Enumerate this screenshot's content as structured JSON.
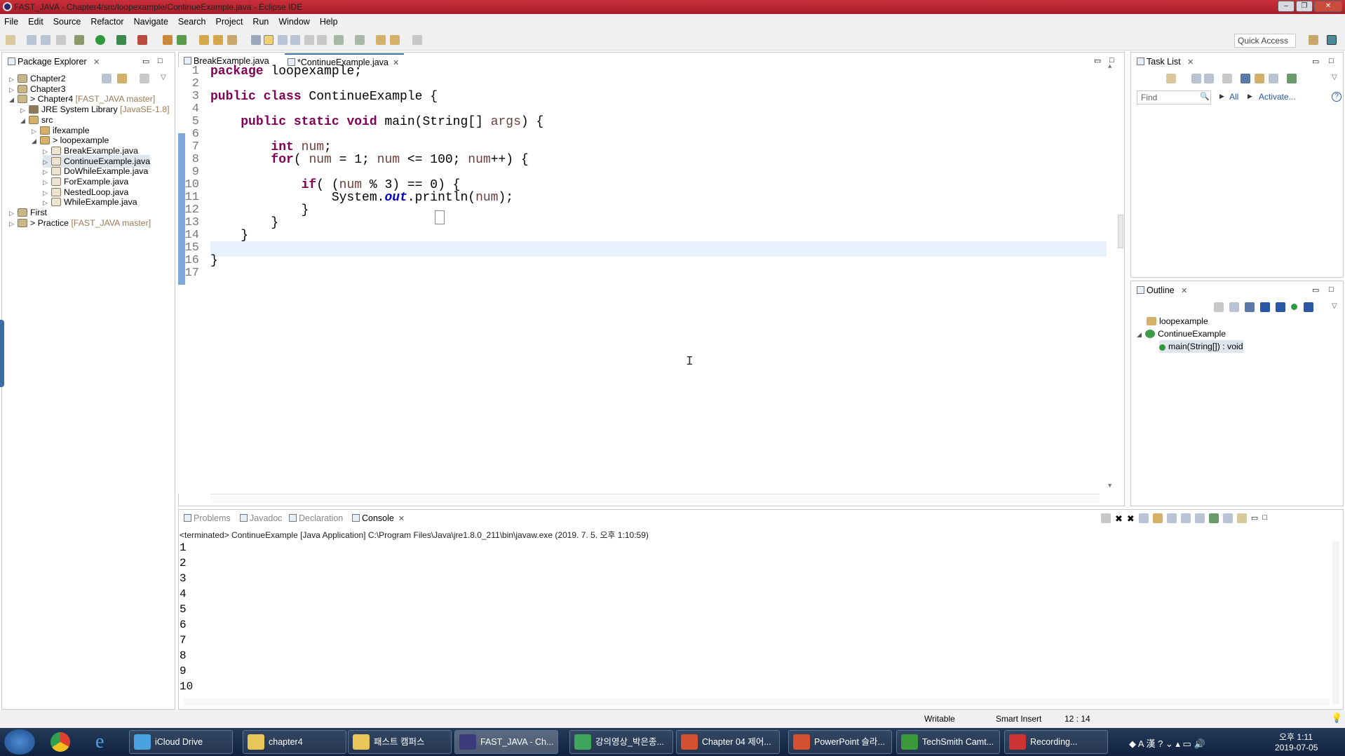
{
  "window": {
    "title": "FAST_JAVA - Chapter4/src/loopexample/ContinueExample.java - Eclipse IDE"
  },
  "menu": [
    "File",
    "Edit",
    "Source",
    "Refactor",
    "Navigate",
    "Search",
    "Project",
    "Run",
    "Window",
    "Help"
  ],
  "quick_access": "Quick Access",
  "package_explorer": {
    "title": "Package Explorer",
    "items": [
      {
        "label": "Chapter2",
        "decor": "",
        "depth": 0,
        "arrow": "▷"
      },
      {
        "label": "Chapter3",
        "decor": "",
        "depth": 0,
        "arrow": "▷"
      },
      {
        "label": "> Chapter4",
        "decor": "[FAST_JAVA master]",
        "depth": 0,
        "arrow": "◢"
      },
      {
        "label": "JRE System Library",
        "decor": "[JavaSE-1.8]",
        "depth": 1,
        "arrow": "▷"
      },
      {
        "label": "src",
        "decor": "",
        "depth": 1,
        "arrow": "◢"
      },
      {
        "label": "ifexample",
        "decor": "",
        "depth": 2,
        "arrow": "▷"
      },
      {
        "label": "> loopexample",
        "decor": "",
        "depth": 2,
        "arrow": "◢"
      },
      {
        "label": "BreakExample.java",
        "decor": "",
        "depth": 3,
        "arrow": "▷"
      },
      {
        "label": "ContinueExample.java",
        "decor": "",
        "depth": 3,
        "arrow": "▷"
      },
      {
        "label": "DoWhileExample.java",
        "decor": "",
        "depth": 3,
        "arrow": "▷"
      },
      {
        "label": "ForExample.java",
        "decor": "",
        "depth": 3,
        "arrow": "▷"
      },
      {
        "label": "NestedLoop.java",
        "decor": "",
        "depth": 3,
        "arrow": "▷"
      },
      {
        "label": "WhileExample.java",
        "decor": "",
        "depth": 3,
        "arrow": "▷"
      },
      {
        "label": "First",
        "decor": "",
        "depth": 0,
        "arrow": "▷"
      },
      {
        "label": "> Practice",
        "decor": "[FAST_JAVA master]",
        "depth": 0,
        "arrow": "▷"
      }
    ]
  },
  "editor_tabs": [
    {
      "label": "BreakExample.java"
    },
    {
      "label": "*ContinueExample.java"
    }
  ],
  "code_lines": [
    {
      "n": "1",
      "code": "<span class=\"kw\">package</span> loopexample;"
    },
    {
      "n": "2",
      "code": ""
    },
    {
      "n": "3",
      "code": "<span class=\"kw\">public class</span> ContinueExample {"
    },
    {
      "n": "4",
      "code": ""
    },
    {
      "n": "5",
      "code": "    <span class=\"kw\">public static void</span> main(String[] <span class=\"ar\">args</span>) {"
    },
    {
      "n": "6",
      "code": ""
    },
    {
      "n": "7",
      "code": "        <span class=\"kw\">int</span> <span class=\"ar\">num</span>;"
    },
    {
      "n": "8",
      "code": "        <span class=\"kw\">for</span>( <span class=\"ar\">num</span> = 1; <span class=\"ar\">num</span> &lt;= 100; <span class=\"ar\">num</span>++) {"
    },
    {
      "n": "9",
      "code": ""
    },
    {
      "n": "10",
      "code": "            <span class=\"kw\">if</span>( (<span class=\"ar\">num</span> % 3) == 0) {"
    },
    {
      "n": "11",
      "code": "                System.<span class=\"it\">out</span>.println(<span class=\"ar\">num</span>);"
    },
    {
      "n": "12",
      "code": "            }"
    },
    {
      "n": "13",
      "code": "        }"
    },
    {
      "n": "14",
      "code": "    }"
    },
    {
      "n": "15",
      "code": ""
    },
    {
      "n": "16",
      "code": "}"
    },
    {
      "n": "17",
      "code": ""
    }
  ],
  "task_list": {
    "title": "Task List",
    "find_placeholder": "Find",
    "all": "All",
    "activate": "Activate..."
  },
  "outline": {
    "title": "Outline",
    "items": [
      "loopexample",
      "ContinueExample",
      "main(String[]) : void"
    ]
  },
  "bottom_tabs": [
    "Problems",
    "Javadoc",
    "Declaration",
    "Console"
  ],
  "console": {
    "header": "<terminated> ContinueExample [Java Application] C:\\Program Files\\Java\\jre1.8.0_211\\bin\\javaw.exe (2019. 7. 5. 오후 1:10:59)",
    "lines": [
      "1",
      "2",
      "3",
      "4",
      "5",
      "6",
      "7",
      "8",
      "9",
      "10"
    ]
  },
  "status": {
    "writable": "Writable",
    "insert": "Smart Insert",
    "position": "12 : 14"
  },
  "taskbar": {
    "items": [
      {
        "label": "iCloud Drive",
        "color": "#4aa3e0"
      },
      {
        "label": "chapter4",
        "color": "#e8c65a"
      },
      {
        "label": "패스트 캠퍼스",
        "color": "#e8c65a"
      },
      {
        "label": "FAST_JAVA - Ch...",
        "color": "#3b3b7a"
      },
      {
        "label": "강의영상_박은종...",
        "color": "#3fa55a"
      },
      {
        "label": "Chapter 04 제어...",
        "color": "#d55030"
      },
      {
        "label": "PowerPoint 슬라...",
        "color": "#d55030"
      },
      {
        "label": "TechSmith Camt...",
        "color": "#3a9a3a"
      },
      {
        "label": "Recording...",
        "color": "#cc3333"
      }
    ],
    "clock_time": "오후 1:11",
    "clock_date": "2019-07-05"
  }
}
